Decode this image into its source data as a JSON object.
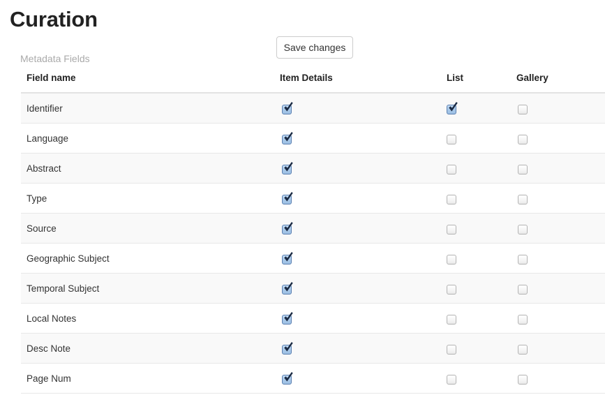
{
  "page": {
    "title": "Curation"
  },
  "toolbar": {
    "save_label": "Save changes"
  },
  "section": {
    "label": "Metadata Fields"
  },
  "table": {
    "headers": {
      "field_name": "Field name",
      "item_details": "Item Details",
      "list": "List",
      "gallery": "Gallery"
    },
    "rows": [
      {
        "name": "Identifier",
        "item_details": true,
        "list": true,
        "gallery": false
      },
      {
        "name": "Language",
        "item_details": true,
        "list": false,
        "gallery": false
      },
      {
        "name": "Abstract",
        "item_details": true,
        "list": false,
        "gallery": false
      },
      {
        "name": "Type",
        "item_details": true,
        "list": false,
        "gallery": false
      },
      {
        "name": "Source",
        "item_details": true,
        "list": false,
        "gallery": false
      },
      {
        "name": "Geographic Subject",
        "item_details": true,
        "list": false,
        "gallery": false
      },
      {
        "name": "Temporal Subject",
        "item_details": true,
        "list": false,
        "gallery": false
      },
      {
        "name": "Local Notes",
        "item_details": true,
        "list": false,
        "gallery": false
      },
      {
        "name": "Desc Note",
        "item_details": true,
        "list": false,
        "gallery": false
      },
      {
        "name": "Page Num",
        "item_details": true,
        "list": false,
        "gallery": false
      }
    ]
  },
  "colors": {
    "title": "#222222",
    "section_label": "#aaaaaa",
    "checkbox_checked_fill": "#a9c9ea",
    "checkbox_checked_border": "#5b7fb0",
    "checkbox_tick": "#1b2b44",
    "row_alt_background": "#f9f9f9",
    "row_border": "#e8e8e8"
  }
}
